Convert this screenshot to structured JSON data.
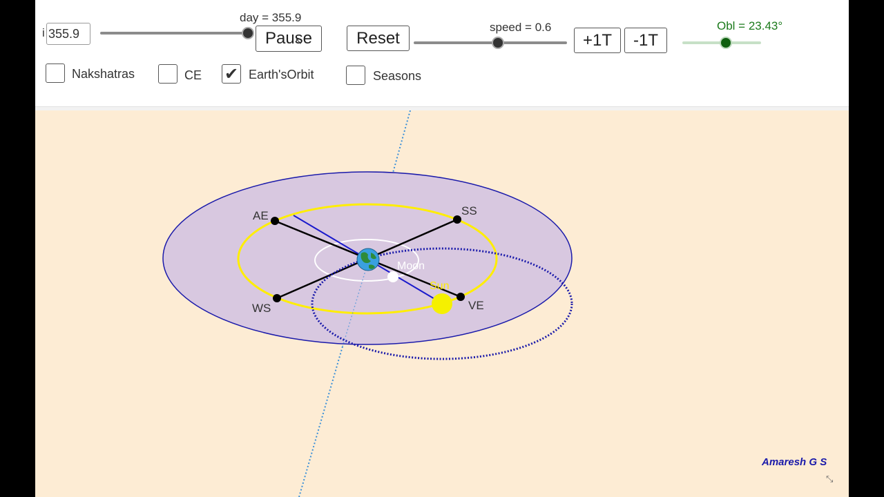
{
  "toolbar": {
    "left_label": "i",
    "day_input_value": "355.9",
    "day_label": "day = 355.9",
    "pause_label": "Pause",
    "reset_label": "Reset",
    "speed_label": "speed = 0.6",
    "plus_one_t_label": "+1T",
    "minus_one_t_label": "-1T",
    "obl_label": "Obl = 23.43°",
    "obl_color": "#1b7a1b"
  },
  "checkboxes": [
    {
      "label": "Nakshatras",
      "checked": false
    },
    {
      "label": "CE",
      "checked": false
    },
    {
      "label": "Earth'sOrbit",
      "checked": true
    },
    {
      "label": "Seasons",
      "checked": false
    }
  ],
  "diagram": {
    "points": [
      "AE",
      "SS",
      "WS",
      "VE"
    ],
    "moon_label": "Moon",
    "sun_label": "Sun",
    "colors": {
      "canvas_bg": "#fdecd4",
      "ecliptic_plane": "#d8c8e0",
      "plane_edge": "#1a1aaa",
      "sun_orbit": "#ffee00",
      "moon_orbit": "#ffffff",
      "earth_orbit_dotted": "#1a1aaa",
      "axis_dotted": "#3a8fd8",
      "sun": "#f5f000"
    }
  },
  "credit": "Amaresh G S",
  "corner_icon": "collapse-icon"
}
